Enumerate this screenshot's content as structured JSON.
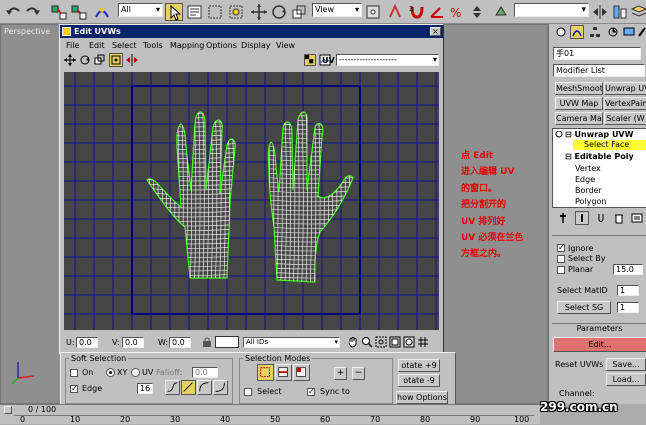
{
  "toolbar": {
    "selection_filter": "All",
    "view_mode": "View"
  },
  "viewport": {
    "label": "Perspective"
  },
  "uvw_window": {
    "title": "Edit UVWs",
    "menu": [
      "File",
      "Edit",
      "Select",
      "Tools",
      "Mapping",
      "Options",
      "Display",
      "View"
    ],
    "map_label": "UV",
    "bottom": {
      "u_label": "U:",
      "u_value": "0.0",
      "v_label": "V:",
      "v_value": "0.0",
      "w_label": "W:",
      "w_value": "0.0",
      "ids_value": "All IDs"
    }
  },
  "soft_selection": {
    "title": "Soft Selection",
    "on_label": "On",
    "xy_label": "XY",
    "uv_label": "UV",
    "falloff_label": "Falloff:",
    "falloff_value": "0.0",
    "edge_label": "Edge",
    "edge_value": "16"
  },
  "selection_modes": {
    "title": "Selection Modes",
    "select_label": "Select",
    "sync_label": "Sync to",
    "rotate_plus": "otate +9",
    "rotate_minus": "otate -9",
    "show_options": "how Options."
  },
  "command_panel": {
    "object_name": "手01",
    "modifier_list": "Modifier List",
    "buttons": [
      "MeshSmooth",
      "Unwrap UVW",
      "UVW Map",
      "VertexPaint",
      "Camera Map",
      "Scaler (W"
    ],
    "stack": [
      {
        "label": "Unwrap UVW",
        "level": 0
      },
      {
        "label": "Select Face",
        "level": 1
      },
      {
        "label": "Editable Poly",
        "level": 0
      },
      {
        "label": "Vertex",
        "level": 1
      },
      {
        "label": "Edge",
        "level": 1
      },
      {
        "label": "Border",
        "level": 1
      },
      {
        "label": "Polygon",
        "level": 1
      }
    ],
    "ignore_label": "Ignore",
    "select_by_label": "Select By",
    "planar_label": "Planar",
    "planar_value": "15.0",
    "select_matid_label": "Select MatID",
    "select_matid_value": "1",
    "select_sg_label": "Select SG",
    "select_sg_value": "1",
    "parameters_label": "Parameters",
    "edit_label": "Edit...",
    "reset_label": "Reset UVWs",
    "save_label": "Save...",
    "load_label": "Load...",
    "channel_label": "Channel:"
  },
  "timeline": {
    "frame_display": "0 / 100",
    "ticks": [
      "0",
      "10",
      "20",
      "30",
      "40",
      "50",
      "60",
      "70",
      "80",
      "90",
      "100"
    ]
  },
  "annotation": [
    "点 Edit",
    "进入编辑 UV",
    "的窗口。",
    "把分割开的",
    "UV 排列好",
    "UV 必须在兰色",
    "方框之内。"
  ],
  "watermark": "299.com.cn",
  "colors": {
    "annotation": "#e60000",
    "uv_background": "#454545",
    "grid_line": "#0000b0",
    "mesh_wire": "#ffffff",
    "mesh_border": "#39ff14",
    "selected_stack": "#ffff33"
  }
}
